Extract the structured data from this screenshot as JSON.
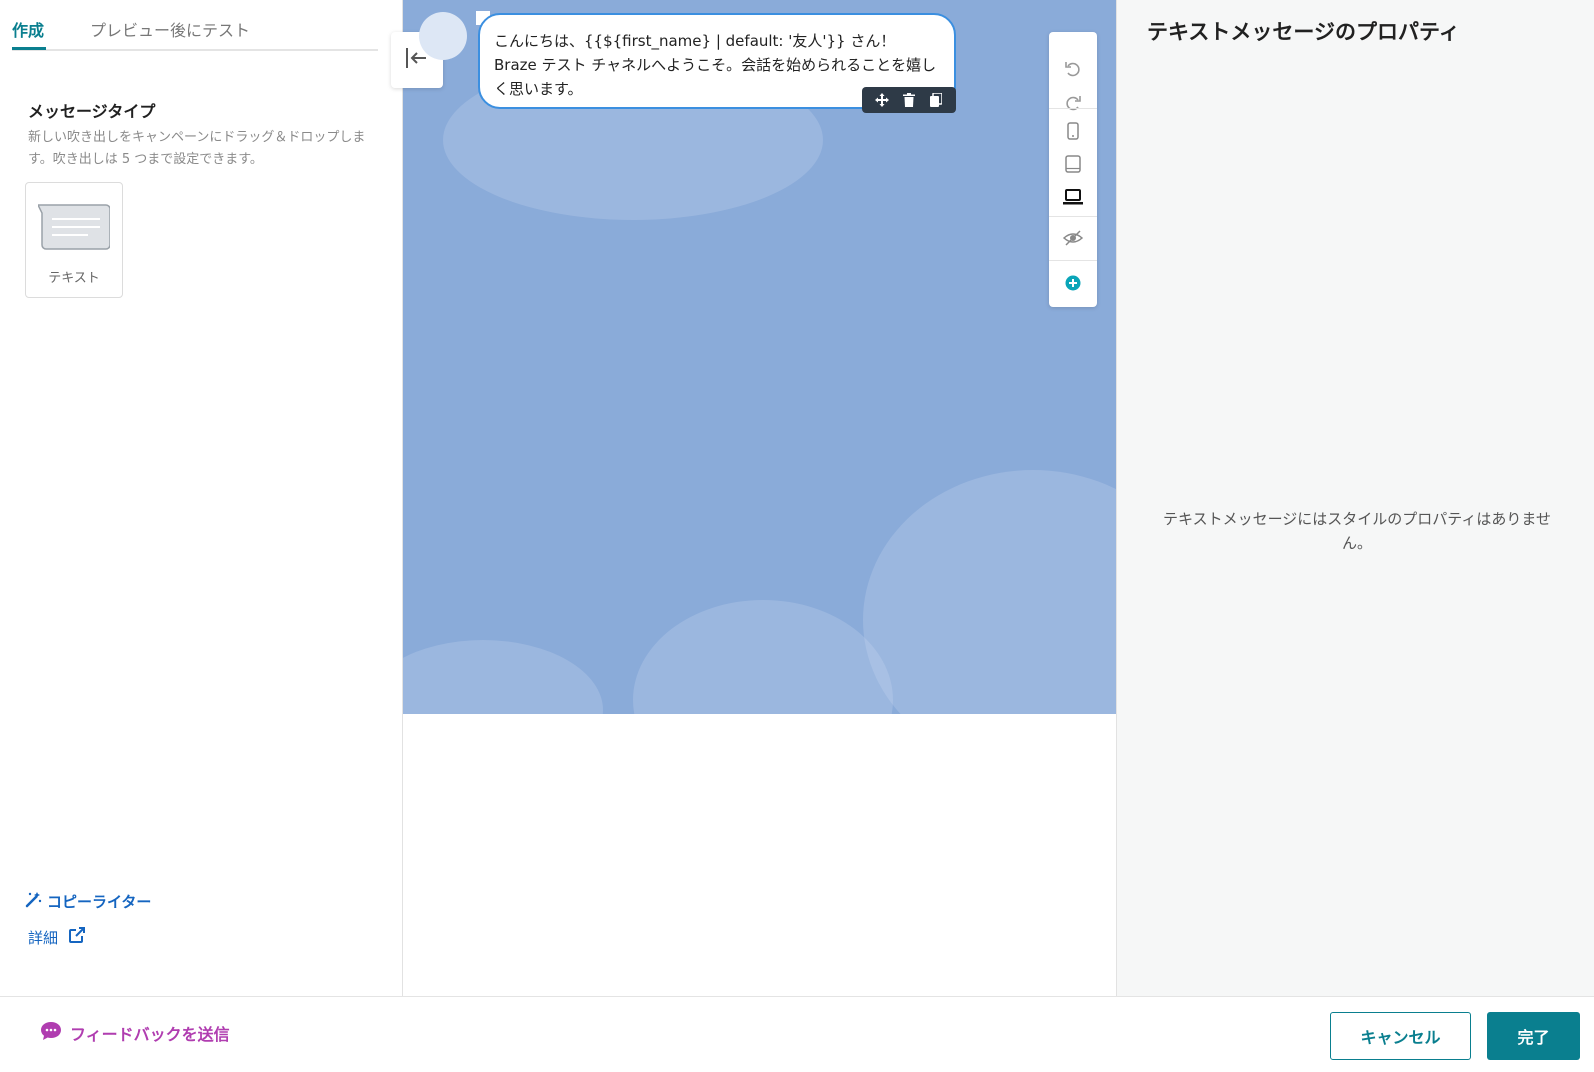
{
  "left_panel": {
    "tabs": [
      {
        "label": "作成",
        "active": true
      },
      {
        "label": "プレビュー後にテスト",
        "active": false
      }
    ],
    "section_title": "メッセージタイプ",
    "section_desc": "新しい吹き出しをキャンペーンにドラッグ＆ドロップします。吹き出しは 5 つまで設定できます。",
    "message_types": [
      {
        "label": "テキスト",
        "icon": "text-message-icon"
      }
    ],
    "copywriter_link": "コピーライター",
    "details_link": "詳細"
  },
  "preview": {
    "bubble_text": "こんにちは、{{${first_name} | default: '友人'}} さん！ Braze テスト チャネルへようこそ。会話を始められることを嬉しく思います。",
    "bubble_toolbar": [
      "move-icon",
      "trash-icon",
      "copy-icon"
    ],
    "side_toolbar": [
      "undo-icon",
      "redo-icon",
      "phone-icon",
      "tablet-icon",
      "laptop-icon",
      "hide-icon",
      "add-icon"
    ],
    "background_color": "#8aabd9"
  },
  "right_panel": {
    "title": "テキストメッセージのプロパティ",
    "empty_text": "テキストメッセージにはスタイルのプロパティはありません。"
  },
  "footer": {
    "feedback_label": "フィードバックを送信",
    "cancel_label": "キャンセル",
    "done_label": "完了"
  },
  "colors": {
    "accent": "#0a7f8f",
    "link": "#1565c0",
    "feedback": "#b03db0"
  }
}
